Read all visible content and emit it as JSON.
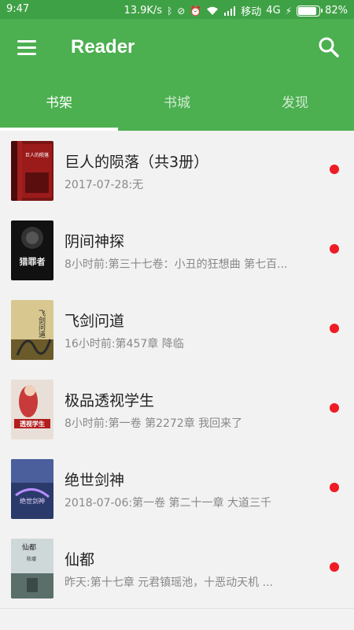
{
  "status": {
    "time": "9:47",
    "speed": "13.9K/s",
    "carrier": "移动",
    "network": "4G",
    "battery": "82%",
    "battery_level": 0.82,
    "icons": [
      "bluetooth-icon",
      "mute-icon",
      "alarm-icon",
      "wifi-icon",
      "signal-icon",
      "charging-icon"
    ]
  },
  "app": {
    "title": "Reader",
    "accent": "#4caf50"
  },
  "tabs": [
    {
      "label": "书架",
      "active": true
    },
    {
      "label": "书城",
      "active": false
    },
    {
      "label": "发现",
      "active": false
    }
  ],
  "books": [
    {
      "title": "巨人的陨落（共3册）",
      "subtitle": "2017-07-28:无",
      "cover": "cover-giants"
    },
    {
      "title": "阴间神探",
      "subtitle": "8小时前:第三十七卷：小丑的狂想曲 第七百...",
      "cover": "cover-detective"
    },
    {
      "title": "飞剑问道",
      "subtitle": "16小时前:第457章 降临",
      "cover": "cover-sword"
    },
    {
      "title": "极品透视学生",
      "subtitle": "8小时前:第一卷 第2272章 我回来了",
      "cover": "cover-student"
    },
    {
      "title": "绝世剑神",
      "subtitle": "2018-07-06:第一卷 第二十一章 大道三千",
      "cover": "cover-swordgod"
    },
    {
      "title": "仙都",
      "subtitle": "昨天:第十七章 元君镇瑶池，十恶动天机 ...",
      "cover": "cover-xiandu"
    }
  ],
  "cover_texts": {
    "giants": "巨人的陨落",
    "detective": "猎罪者",
    "sword": "飞剑问道",
    "student": "透视学生",
    "swordgod": "绝世剑神",
    "xiandu": "仙都",
    "xiandu_author": "陈瓔"
  },
  "colors": {
    "unread_dot": "#ee1c24",
    "statusbar": "#3fa146"
  }
}
